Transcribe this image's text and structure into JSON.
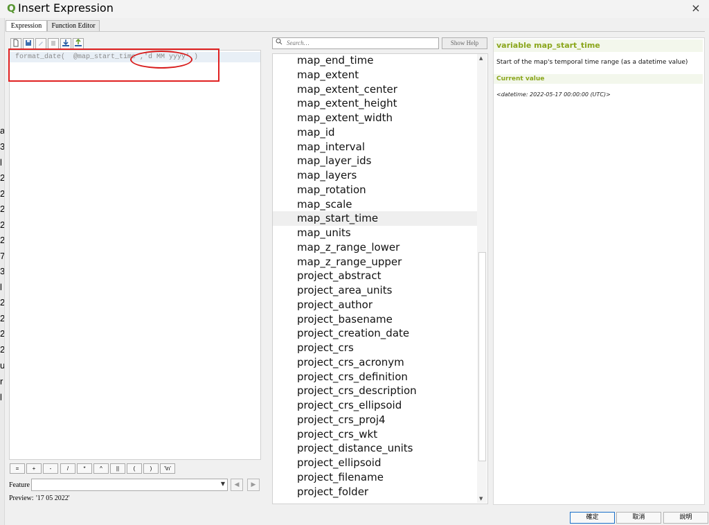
{
  "window": {
    "title": "Insert Expression",
    "logo_glyph": "Q",
    "close_glyph": "×"
  },
  "tabs": [
    {
      "label": "Expression",
      "active": true
    },
    {
      "label": "Function Editor",
      "active": false
    }
  ],
  "toolbar": {
    "icons": [
      "new-file-icon",
      "save-icon",
      "edit-icon",
      "delete-icon",
      "import-icon",
      "export-icon"
    ]
  },
  "editor": {
    "expression": "format_date(  @map_start_time ,'d MM yyyy' )"
  },
  "operators": [
    "=",
    "+",
    "-",
    "/",
    "*",
    "^",
    "||",
    "(",
    ")",
    "'\\n'"
  ],
  "feature": {
    "label": "Feature",
    "value": ""
  },
  "preview": {
    "label": "Preview:",
    "value": "'17 05 2022'"
  },
  "search": {
    "placeholder": "Search…",
    "value": ""
  },
  "show_help_label": "Show Help",
  "list": {
    "items": [
      "map_end_time",
      "map_extent",
      "map_extent_center",
      "map_extent_height",
      "map_extent_width",
      "map_id",
      "map_interval",
      "map_layer_ids",
      "map_layers",
      "map_rotation",
      "map_scale",
      "map_start_time",
      "map_units",
      "map_z_range_lower",
      "map_z_range_upper",
      "project_abstract",
      "project_area_units",
      "project_author",
      "project_basename",
      "project_creation_date",
      "project_crs",
      "project_crs_acronym",
      "project_crs_definition",
      "project_crs_description",
      "project_crs_ellipsoid",
      "project_crs_proj4",
      "project_crs_wkt",
      "project_distance_units",
      "project_ellipsoid",
      "project_filename",
      "project_folder"
    ],
    "selected": "map_start_time"
  },
  "help": {
    "title": "variable map_start_time",
    "description": "Start of the map's temporal time range (as a datetime value)",
    "current_value_label": "Current value",
    "current_value": "<datetime: 2022-05-17 00:00:00 (UTC)>"
  },
  "buttons": {
    "ok": "確定",
    "cancel": "取消",
    "help": "說明"
  },
  "colors": {
    "accent_green": "#8aa61b",
    "annotation_red": "#e02020",
    "ok_border": "#1a6fc9"
  },
  "gutter_glyphs": [
    "a",
    "3",
    "l",
    "2",
    "2",
    "2",
    "2",
    "2",
    "7",
    "3",
    "l",
    "2",
    "2",
    "2",
    "2",
    "u",
    "r",
    "l"
  ]
}
